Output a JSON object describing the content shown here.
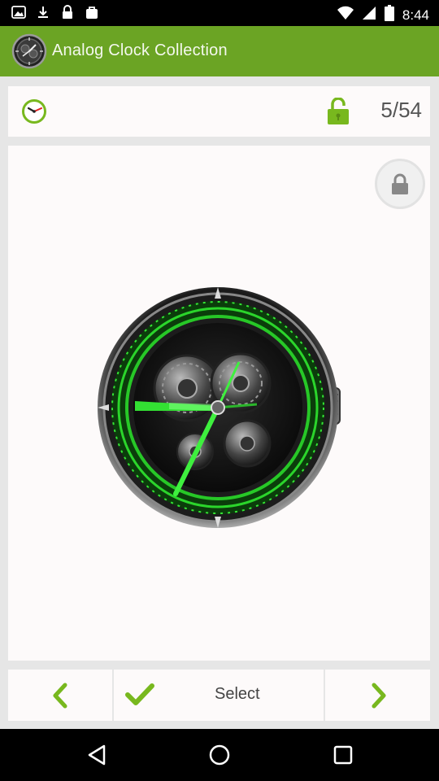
{
  "status_bar": {
    "time": "8:44",
    "icons": [
      "gallery-icon",
      "download-icon",
      "lock-status-icon",
      "bag-icon",
      "wifi-icon",
      "signal-icon",
      "battery-icon"
    ]
  },
  "header": {
    "title": "Analog Clock Collection",
    "logo": "clock-logo-icon"
  },
  "counter": {
    "current": "5/54",
    "left_icon": "clock-icon",
    "lock_state_icon": "unlock-icon"
  },
  "preview": {
    "locked_badge_icon": "lock-icon",
    "item_image": "analog-clock-preview"
  },
  "toolbar": {
    "prev_icon": "chevron-left-icon",
    "select_icon": "checkmark-icon",
    "select_label": "Select",
    "next_icon": "chevron-right-icon"
  },
  "navigation": [
    "back-icon",
    "home-icon",
    "recents-icon"
  ],
  "colors": {
    "accent": "#6ba424",
    "icon_green": "#78b81e",
    "surface": "#fdfafa",
    "background": "#e6e6e6"
  }
}
